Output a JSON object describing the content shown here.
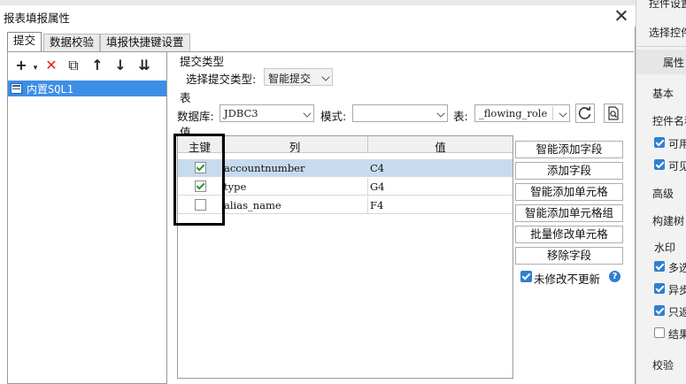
{
  "dialog": {
    "title": "报表填报属性",
    "tabs": [
      "提交",
      "数据校验",
      "填报快捷键设置"
    ]
  },
  "left_panel": {
    "toolbar_icons": [
      "add-icon",
      "delete-icon",
      "copy-icon",
      "move-up-icon",
      "move-down-icon",
      "move-bottom-icon"
    ],
    "toolbar_glyphs": {
      "add": "+",
      "delete": "✕",
      "copy": "⧉",
      "up": "↑",
      "down": "↓",
      "bottom": "⇊"
    },
    "tree_items": [
      {
        "label": "内置SQL1",
        "selected": true
      }
    ]
  },
  "submit_type": {
    "section": "提交类型",
    "label": "选择提交类型:",
    "value": "智能提交"
  },
  "table_section": {
    "section": "表",
    "db_label": "数据库:",
    "db_value": "JDBC3",
    "mode_label": "模式:",
    "mode_value": "",
    "table_label": "表:",
    "table_value": "_flowing_role"
  },
  "value_section": {
    "section": "值",
    "headers": {
      "key": "主键",
      "column": "列",
      "value": "值"
    },
    "rows": [
      {
        "key": true,
        "column": "accountnumber",
        "value": "C4",
        "selected": true
      },
      {
        "key": true,
        "column": "type",
        "value": "G4",
        "selected": false
      },
      {
        "key": false,
        "column": "alias_name",
        "value": "F4",
        "selected": false
      }
    ]
  },
  "actions": {
    "smart_add_field": "智能添加字段",
    "add_field": "添加字段",
    "smart_add_cell": "智能添加单元格",
    "smart_add_cell_group": "智能添加单元格组",
    "batch_modify_cell": "批量修改单元格",
    "remove_field": "移除字段",
    "no_update_label": "未修改不更新",
    "no_update_checked": true
  },
  "background_panel": {
    "items": [
      "控件设置",
      "选择控件",
      "属性",
      "基本",
      "控件名称",
      "可用",
      "可见",
      "高级",
      "构建树",
      "水印",
      "多选",
      "异步",
      "只返",
      "结果",
      "校验"
    ]
  },
  "colors": {
    "selection": "#3d8ee6",
    "row_selected": "#c7dbee",
    "check_green": "#1f9b2a",
    "accent_blue": "#2f7fd1",
    "delete_red": "#e02222"
  }
}
